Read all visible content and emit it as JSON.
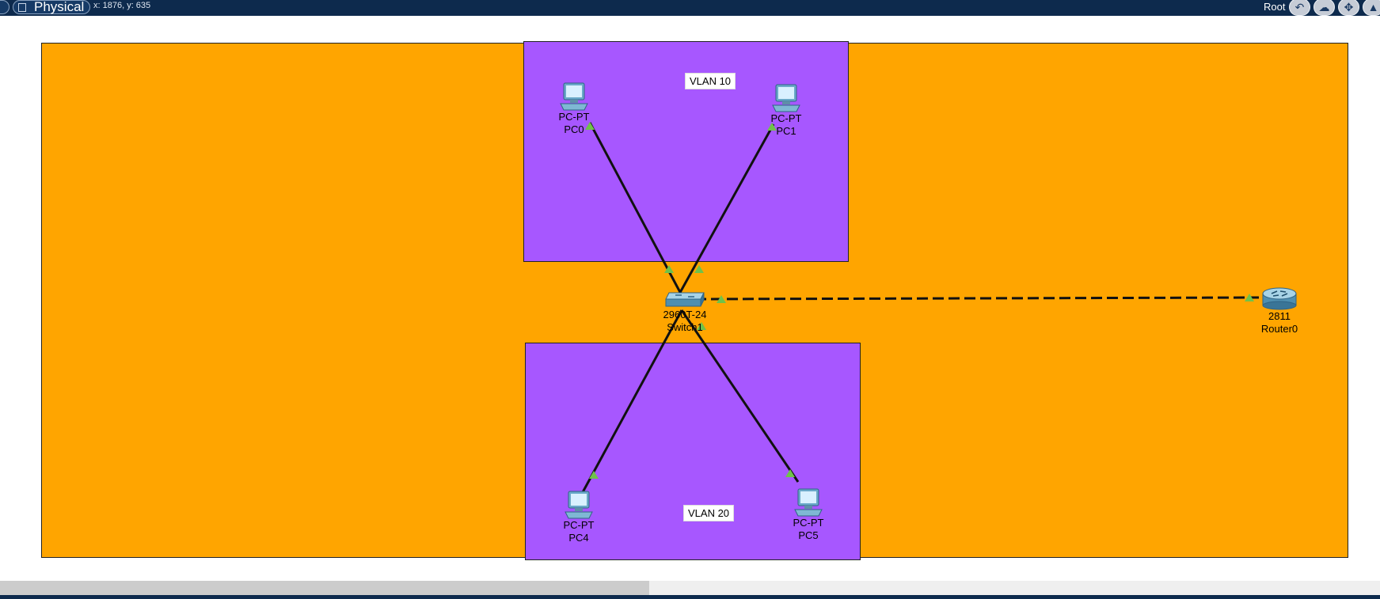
{
  "topbar": {
    "view_mode": "Physical",
    "coordinates": "x: 1876, y: 635",
    "location": "Root",
    "icons": [
      "back-icon",
      "cloud-icon",
      "move-icon",
      "zoom-icon"
    ]
  },
  "zones": {
    "vlan10": "VLAN 10",
    "vlan20": "VLAN 20"
  },
  "devices": {
    "pc0": {
      "model": "PC-PT",
      "name": "PC0"
    },
    "pc1": {
      "model": "PC-PT",
      "name": "PC1"
    },
    "pc4": {
      "model": "PC-PT",
      "name": "PC4"
    },
    "pc5": {
      "model": "PC-PT",
      "name": "PC5"
    },
    "switch1": {
      "model": "2960-24TT",
      "display_model": "2960T-24",
      "name": "Switch1"
    },
    "router0": {
      "model": "2811",
      "name": "Router0"
    }
  },
  "colors": {
    "topbar": "#0d2a4d",
    "cluster_bg": "#ffa500",
    "vlan_bg": "#a757ff",
    "link_up": "#6fc24a",
    "cable": "#111111"
  }
}
